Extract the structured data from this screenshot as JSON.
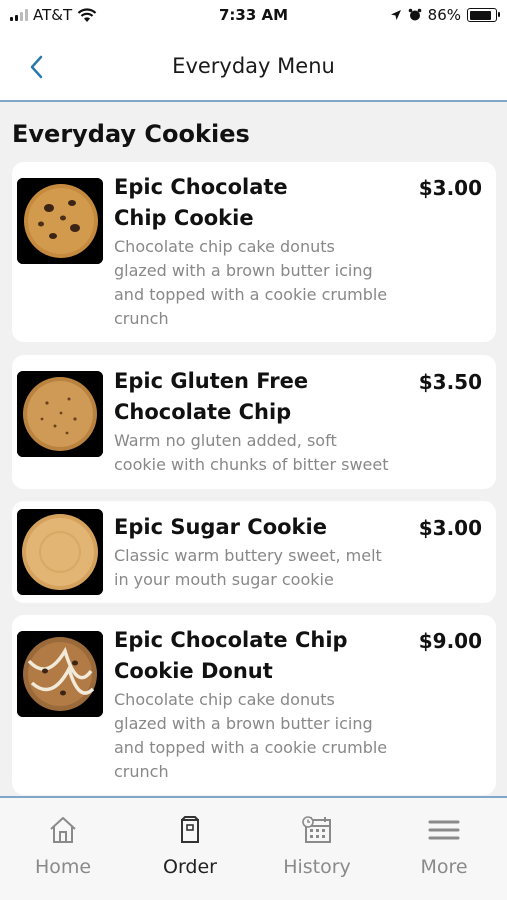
{
  "status_bar": {
    "carrier": "AT&T",
    "time": "7:33 AM",
    "battery": "86%",
    "battery_level": 0.86
  },
  "nav": {
    "title": "Everyday Menu",
    "back_icon": "chevron-left-icon",
    "accent_color": "#2a7ab0"
  },
  "section": {
    "title": "Everyday Cookies"
  },
  "items": [
    {
      "name_line1": "Epic Chocolate",
      "name_line2": "Chip Cookie",
      "price": "$3.00",
      "desc_lines": [
        "Chocolate chip cake donuts",
        "glazed with a brown butter icing",
        "and topped with a cookie crumble",
        "crunch"
      ]
    },
    {
      "name_line1": "Epic Gluten Free",
      "name_line2": "Chocolate Chip",
      "price": "$3.50",
      "desc_lines": [
        "Warm no gluten added, soft",
        "cookie with chunks of bitter sweet"
      ]
    },
    {
      "name_line1": "Epic Sugar Cookie",
      "price": "$3.00",
      "desc_lines": [
        "Classic warm buttery sweet, melt",
        "in your mouth sugar cookie"
      ]
    },
    {
      "name_line1": "Epic Chocolate Chip",
      "name_line2": "Cookie Donut",
      "price": "$9.00",
      "desc_lines": [
        "Chocolate chip cake donuts",
        "glazed with a brown butter icing",
        "and topped with a cookie crumble",
        "crunch"
      ]
    }
  ],
  "tab_bar": {
    "tabs": [
      {
        "label": "Home",
        "icon": "home-icon"
      },
      {
        "label": "Order",
        "icon": "order-bag-icon",
        "active": true
      },
      {
        "label": "History",
        "icon": "calendar-history-icon"
      },
      {
        "label": "More",
        "icon": "hamburger-menu-icon"
      }
    ]
  }
}
